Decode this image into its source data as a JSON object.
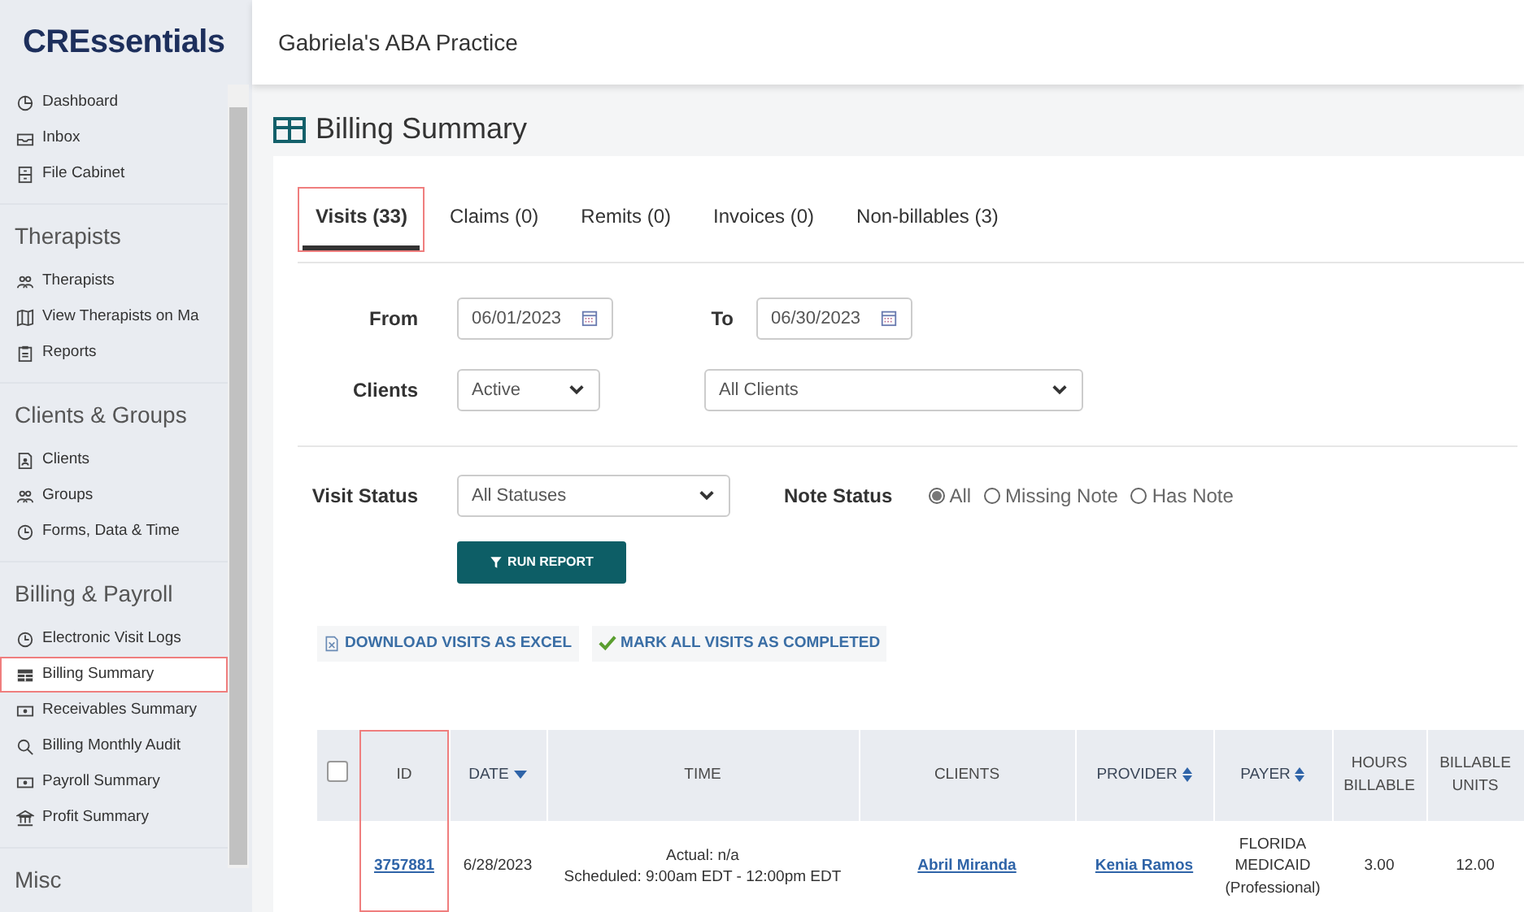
{
  "logo": {
    "text": "CREssentials"
  },
  "sidebar": {
    "sections": [
      {
        "items": [
          {
            "label": "Dashboard",
            "selected": false,
            "highlighted": false
          },
          {
            "label": "Inbox",
            "selected": false,
            "highlighted": false
          },
          {
            "label": "File Cabinet",
            "selected": false,
            "highlighted": false
          }
        ]
      },
      {
        "heading": "Therapists",
        "items": [
          {
            "label": "Therapists",
            "selected": false,
            "highlighted": false
          },
          {
            "label": "View Therapists on Ma",
            "selected": false,
            "highlighted": false
          },
          {
            "label": "Reports",
            "selected": false,
            "highlighted": false
          }
        ]
      },
      {
        "heading": "Clients & Groups",
        "items": [
          {
            "label": "Clients",
            "selected": false,
            "highlighted": false
          },
          {
            "label": "Groups",
            "selected": false,
            "highlighted": false
          },
          {
            "label": "Forms, Data & Time",
            "selected": false,
            "highlighted": false
          }
        ]
      },
      {
        "heading": "Billing & Payroll",
        "items": [
          {
            "label": "Electronic Visit Logs",
            "selected": false,
            "highlighted": false
          },
          {
            "label": "Billing Summary",
            "selected": true,
            "highlighted": true
          },
          {
            "label": "Receivables Summary",
            "selected": false,
            "highlighted": false
          },
          {
            "label": "Billing Monthly Audit",
            "selected": false,
            "highlighted": false
          },
          {
            "label": "Payroll Summary",
            "selected": false,
            "highlighted": false
          },
          {
            "label": "Profit Summary",
            "selected": false,
            "highlighted": false
          }
        ]
      },
      {
        "heading": "Misc"
      }
    ]
  },
  "header": {
    "practice": "Gabriela's ABA Practice"
  },
  "page": {
    "title": "Billing Summary"
  },
  "tabs": [
    {
      "label": "Visits (33)",
      "selected": true,
      "highlighted": true
    },
    {
      "label": "Claims (0)",
      "selected": false,
      "highlighted": false
    },
    {
      "label": "Remits (0)",
      "selected": false,
      "highlighted": false
    },
    {
      "label": "Invoices (0)",
      "selected": false,
      "highlighted": false
    },
    {
      "label": "Non-billables (3)",
      "selected": false,
      "highlighted": false
    }
  ],
  "filters": {
    "from": {
      "label": "From",
      "value": "06/01/2023"
    },
    "to": {
      "label": "To",
      "value": "06/30/2023"
    },
    "clients": {
      "label": "Clients",
      "status": "Active",
      "client": "All Clients"
    },
    "visit_status": {
      "label": "Visit Status",
      "value": "All Statuses"
    },
    "note_status": {
      "label": "Note Status",
      "options": [
        {
          "label": "All",
          "selected": true
        },
        {
          "label": "Missing Note",
          "selected": false
        },
        {
          "label": "Has Note",
          "selected": false
        }
      ]
    },
    "run_button": "RUN REPORT"
  },
  "actions": [
    {
      "kind": "excel",
      "label": "DOWNLOAD VISITS AS EXCEL"
    },
    {
      "kind": "complete",
      "label": "MARK ALL VISITS AS COMPLETED"
    }
  ],
  "table": {
    "select_all": {
      "checked": false
    },
    "columns": [
      {
        "label": "ID",
        "sortable": false,
        "sorted": false,
        "highlighted": true
      },
      {
        "label": "DATE",
        "sortable": true,
        "sorted": true,
        "highlighted": false
      },
      {
        "label": "TIME",
        "sortable": false,
        "sorted": false,
        "highlighted": false
      },
      {
        "label": "CLIENTS",
        "sortable": false,
        "sorted": false,
        "highlighted": false
      },
      {
        "label": "PROVIDER",
        "sortable": true,
        "sorted": false,
        "highlighted": false
      },
      {
        "label": "PAYER",
        "sortable": true,
        "sorted": false,
        "highlighted": false
      },
      {
        "label": "HOURS BILLABLE",
        "sortable": false,
        "sorted": false,
        "highlighted": false
      },
      {
        "label": "BILLABLE UNITS",
        "sortable": false,
        "sorted": false,
        "highlighted": false
      }
    ],
    "rows": [
      {
        "id": "3757881",
        "date": "6/28/2023",
        "time": [
          "Actual: n/a",
          "Scheduled: 9:00am EDT - 12:00pm EDT"
        ],
        "clients": "Abril Miranda",
        "provider": "Kenia Ramos",
        "payer": "FLORIDA MEDICAID (Professional)",
        "hours_billable": "3.00",
        "billable_units": "12.00"
      }
    ]
  }
}
